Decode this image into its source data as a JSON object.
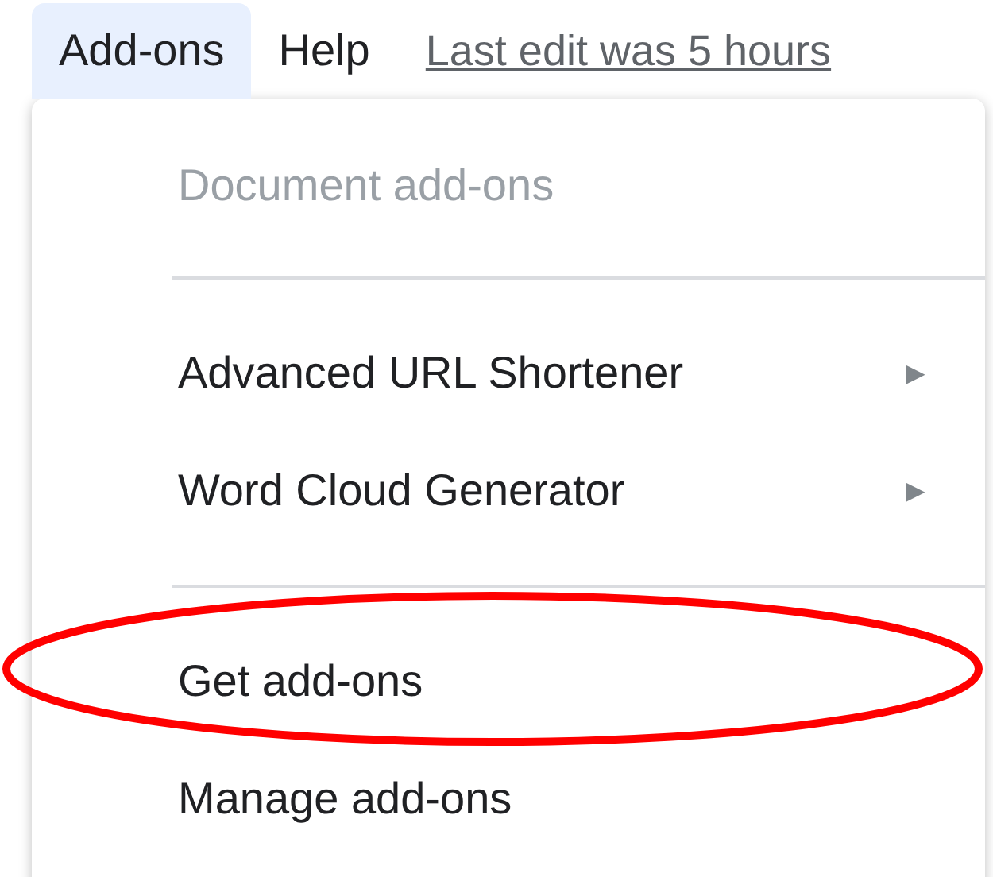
{
  "menu_bar": [
    {
      "label": "Add-ons",
      "selected": true
    },
    {
      "label": "Help",
      "selected": false
    }
  ],
  "last_edit": "Last edit was 5 hours",
  "menu": {
    "items": [
      {
        "kind": "header",
        "label": "Document add-ons"
      },
      {
        "kind": "separator"
      },
      {
        "kind": "submenu",
        "label": "Advanced URL Shortener",
        "arrow": "▶"
      },
      {
        "kind": "submenu",
        "label": "Word Cloud Generator",
        "arrow": "▶"
      },
      {
        "kind": "separator"
      },
      {
        "kind": "item",
        "label": "Get add-ons"
      },
      {
        "kind": "item",
        "label": "Manage add-ons"
      }
    ]
  }
}
